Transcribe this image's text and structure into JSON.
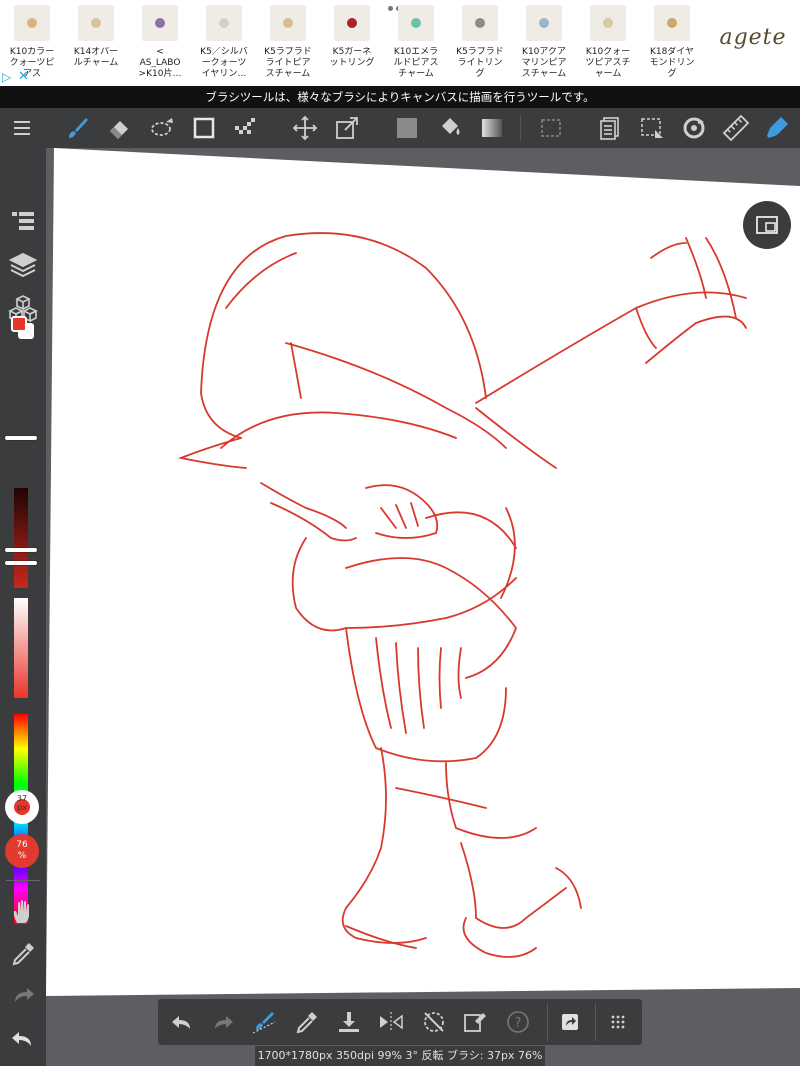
{
  "ad": {
    "items": [
      {
        "label": "K10カラー\nクォーツピ\nアス"
      },
      {
        "label": "K14オパー\nルチャーム"
      },
      {
        "label": "<\nAS_LABO\n>K10片…"
      },
      {
        "label": "K5／シルバ\nークォーツ\nイヤリン…"
      },
      {
        "label": "K5ラブラド\nライトピア\nスチャーム"
      },
      {
        "label": "K5ガーネ\nットリング"
      },
      {
        "label": "K10エメラ\nルドピアス\nチャーム"
      },
      {
        "label": "K5ラブラド\nライトリン\nグ"
      },
      {
        "label": "K10アクア\nマリンピア\nスチャーム"
      },
      {
        "label": "K10クォー\nツピアスチ\nャーム"
      },
      {
        "label": "K18ダイヤ\nモンドリン\nグ"
      }
    ],
    "brand": "agete",
    "info_icon": "info-triangle-icon",
    "close_icon": "close-x-icon"
  },
  "hint": "ブラシツールは、様々なブラシによりキャンバスに描画を行うツールです。",
  "toolbar": {
    "tools": [
      "menu",
      "brush",
      "eraser",
      "lasso-select",
      "rectangle",
      "dot-pen",
      "move",
      "transform",
      "fill-color",
      "bucket",
      "gradient",
      "selection",
      "layer-copy",
      "select-tool",
      "rotate",
      "ruler",
      "pen-active"
    ]
  },
  "left": {
    "primary_color": "#e8352a",
    "secondary_color": "#ffffff",
    "brush_size": "37\npx",
    "opacity": "76\n%"
  },
  "status": "1700*1780px 350dpi 99% 3° 反転 ブラシ: 37px 76%",
  "colors": {
    "accent": "#2aa3d8",
    "stroke": "#d9392d"
  }
}
